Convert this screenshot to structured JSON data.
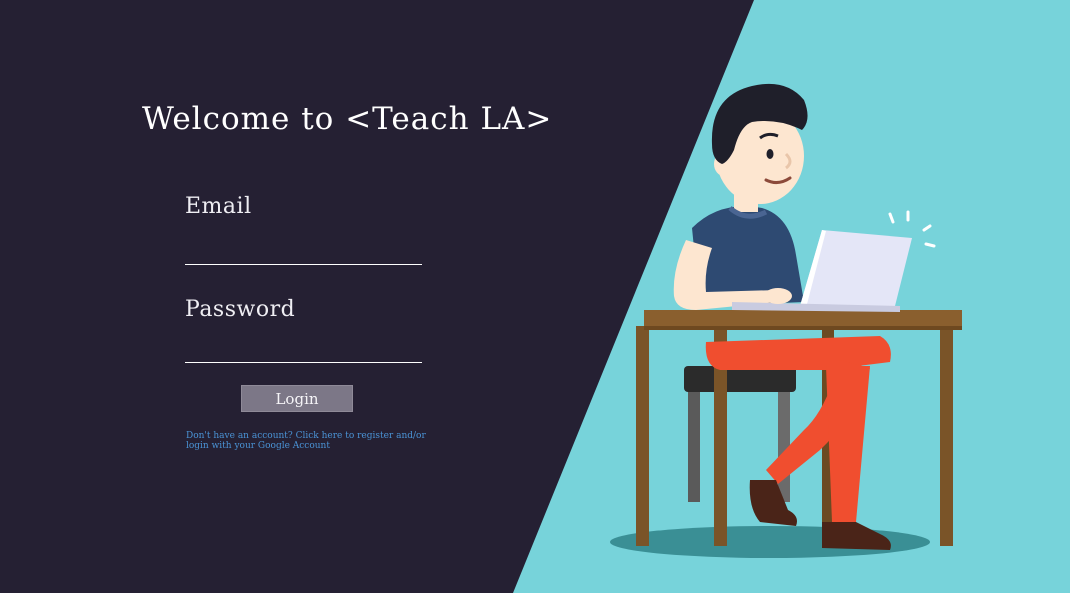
{
  "page": {
    "title": "Welcome to <Teach LA>"
  },
  "login_form": {
    "email_label": "Email",
    "email_value": "",
    "password_label": "Password",
    "password_value": "",
    "login_button_label": "Login",
    "register_link_text": "Don't have an account? Click here to register and/or login with your Google Account"
  },
  "illustration": {
    "icon": "person-at-laptop-illustration"
  },
  "colors": {
    "panel_background": "#252033",
    "accent_background": "#77d3da",
    "button_background": "#7c7787",
    "link_color": "#4a93d6",
    "text_color": "#ffffff"
  }
}
